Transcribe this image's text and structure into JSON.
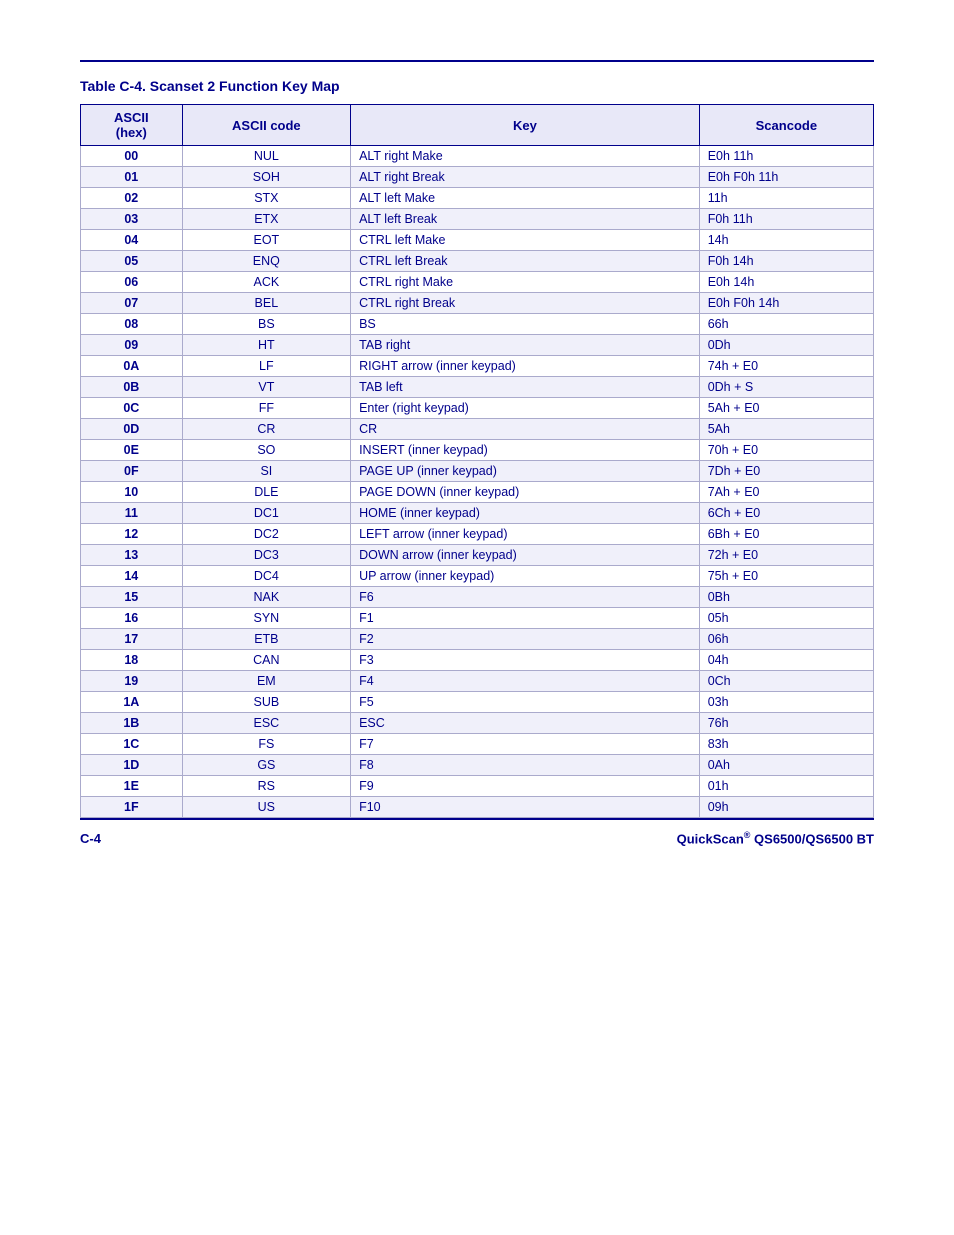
{
  "page": {
    "top_rule": true,
    "table_title": "Table C-4. Scanset 2 Function Key Map",
    "table": {
      "headers": [
        "ASCII\n(hex)",
        "ASCII code",
        "Key",
        "Scancode"
      ],
      "rows": [
        [
          "00",
          "NUL",
          "ALT right Make",
          "E0h 11h"
        ],
        [
          "01",
          "SOH",
          "ALT right Break",
          "E0h F0h 11h"
        ],
        [
          "02",
          "STX",
          "ALT left Make",
          "11h"
        ],
        [
          "03",
          "ETX",
          "ALT left Break",
          "F0h 11h"
        ],
        [
          "04",
          "EOT",
          "CTRL left Make",
          "14h"
        ],
        [
          "05",
          "ENQ",
          "CTRL left Break",
          "F0h 14h"
        ],
        [
          "06",
          "ACK",
          "CTRL right Make",
          "E0h 14h"
        ],
        [
          "07",
          "BEL",
          "CTRL right Break",
          "E0h F0h 14h"
        ],
        [
          "08",
          "BS",
          "BS",
          "66h"
        ],
        [
          "09",
          "HT",
          "TAB right",
          "0Dh"
        ],
        [
          "0A",
          "LF",
          "RIGHT arrow (inner keypad)",
          "74h + E0"
        ],
        [
          "0B",
          "VT",
          "TAB left",
          "0Dh + S"
        ],
        [
          "0C",
          "FF",
          "Enter (right keypad)",
          "5Ah + E0"
        ],
        [
          "0D",
          "CR",
          "CR",
          "5Ah"
        ],
        [
          "0E",
          "SO",
          "INSERT (inner keypad)",
          "70h + E0"
        ],
        [
          "0F",
          "SI",
          "PAGE UP (inner keypad)",
          "7Dh + E0"
        ],
        [
          "10",
          "DLE",
          "PAGE DOWN (inner keypad)",
          "7Ah + E0"
        ],
        [
          "11",
          "DC1",
          "HOME (inner keypad)",
          "6Ch + E0"
        ],
        [
          "12",
          "DC2",
          "LEFT arrow (inner keypad)",
          "6Bh + E0"
        ],
        [
          "13",
          "DC3",
          "DOWN arrow (inner keypad)",
          "72h + E0"
        ],
        [
          "14",
          "DC4",
          "UP arrow (inner keypad)",
          "75h + E0"
        ],
        [
          "15",
          "NAK",
          "F6",
          "0Bh"
        ],
        [
          "16",
          "SYN",
          "F1",
          "05h"
        ],
        [
          "17",
          "ETB",
          "F2",
          "06h"
        ],
        [
          "18",
          "CAN",
          "F3",
          "04h"
        ],
        [
          "19",
          "EM",
          "F4",
          "0Ch"
        ],
        [
          "1A",
          "SUB",
          "F5",
          "03h"
        ],
        [
          "1B",
          "ESC",
          "ESC",
          "76h"
        ],
        [
          "1C",
          "FS",
          "F7",
          "83h"
        ],
        [
          "1D",
          "GS",
          "F8",
          "0Ah"
        ],
        [
          "1E",
          "RS",
          "F9",
          "01h"
        ],
        [
          "1F",
          "US",
          "F10",
          "09h"
        ]
      ]
    },
    "footer": {
      "left": "C-4",
      "right": "QuickScan® QS6500/QS6500 BT"
    }
  }
}
